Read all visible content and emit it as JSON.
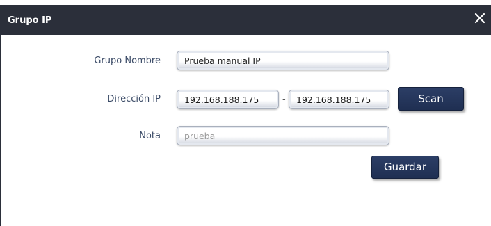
{
  "dialog": {
    "title": "Grupo IP",
    "close_icon": "close-icon"
  },
  "form": {
    "group_name": {
      "label": "Grupo Nombre",
      "value": "Prueba manual IP"
    },
    "ip_address": {
      "label": "Dirección IP",
      "start_value": "192.168.188.175",
      "separator": "-",
      "end_value": "192.168.188.175",
      "scan_label": "Scan"
    },
    "note": {
      "label": "Nota",
      "placeholder": "prueba",
      "value": ""
    },
    "save_label": "Guardar"
  },
  "colors": {
    "titlebar": "#2b2f3a",
    "button": "#1f2f52",
    "label_text": "#3a4a66"
  }
}
